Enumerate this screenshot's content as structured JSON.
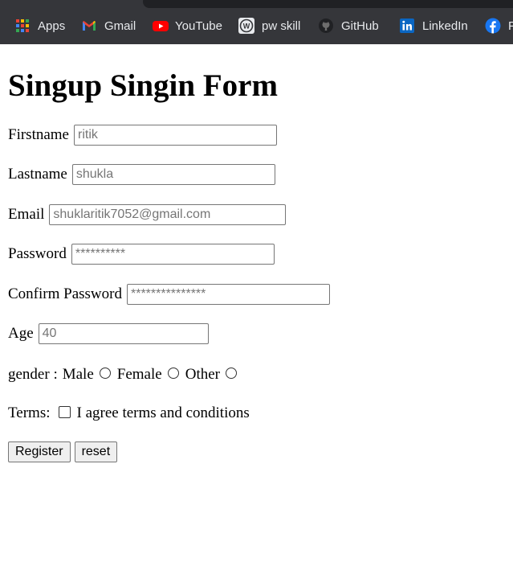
{
  "bookmarks": [
    {
      "label": "Apps",
      "icon": "apps-grid-icon"
    },
    {
      "label": "Gmail",
      "icon": "gmail-icon"
    },
    {
      "label": "YouTube",
      "icon": "youtube-icon"
    },
    {
      "label": "pw skill",
      "icon": "wordpress-icon"
    },
    {
      "label": "GitHub",
      "icon": "github-icon"
    },
    {
      "label": "LinkedIn",
      "icon": "linkedin-icon"
    },
    {
      "label": "F",
      "icon": "facebook-icon"
    }
  ],
  "form": {
    "title": "Singup Singin Form",
    "firstname": {
      "label": "Firstname",
      "placeholder": "ritik"
    },
    "lastname": {
      "label": "Lastname",
      "placeholder": "shukla"
    },
    "email": {
      "label": "Email",
      "placeholder": "shuklaritik7052@gmail.com"
    },
    "password": {
      "label": "Password",
      "placeholder": "**********"
    },
    "confirm_password": {
      "label": "Confirm Password",
      "placeholder": "***************"
    },
    "age": {
      "label": "Age",
      "placeholder": "40"
    },
    "gender": {
      "label": "gender :",
      "options": [
        "Male",
        "Female",
        "Other"
      ]
    },
    "terms": {
      "label": "Terms:",
      "text": "I agree terms and conditions"
    },
    "buttons": {
      "register": "Register",
      "reset": "reset"
    }
  },
  "colors": {
    "bookmarks_bar": "#35363a",
    "bookmark_text": "#e8eaed"
  }
}
